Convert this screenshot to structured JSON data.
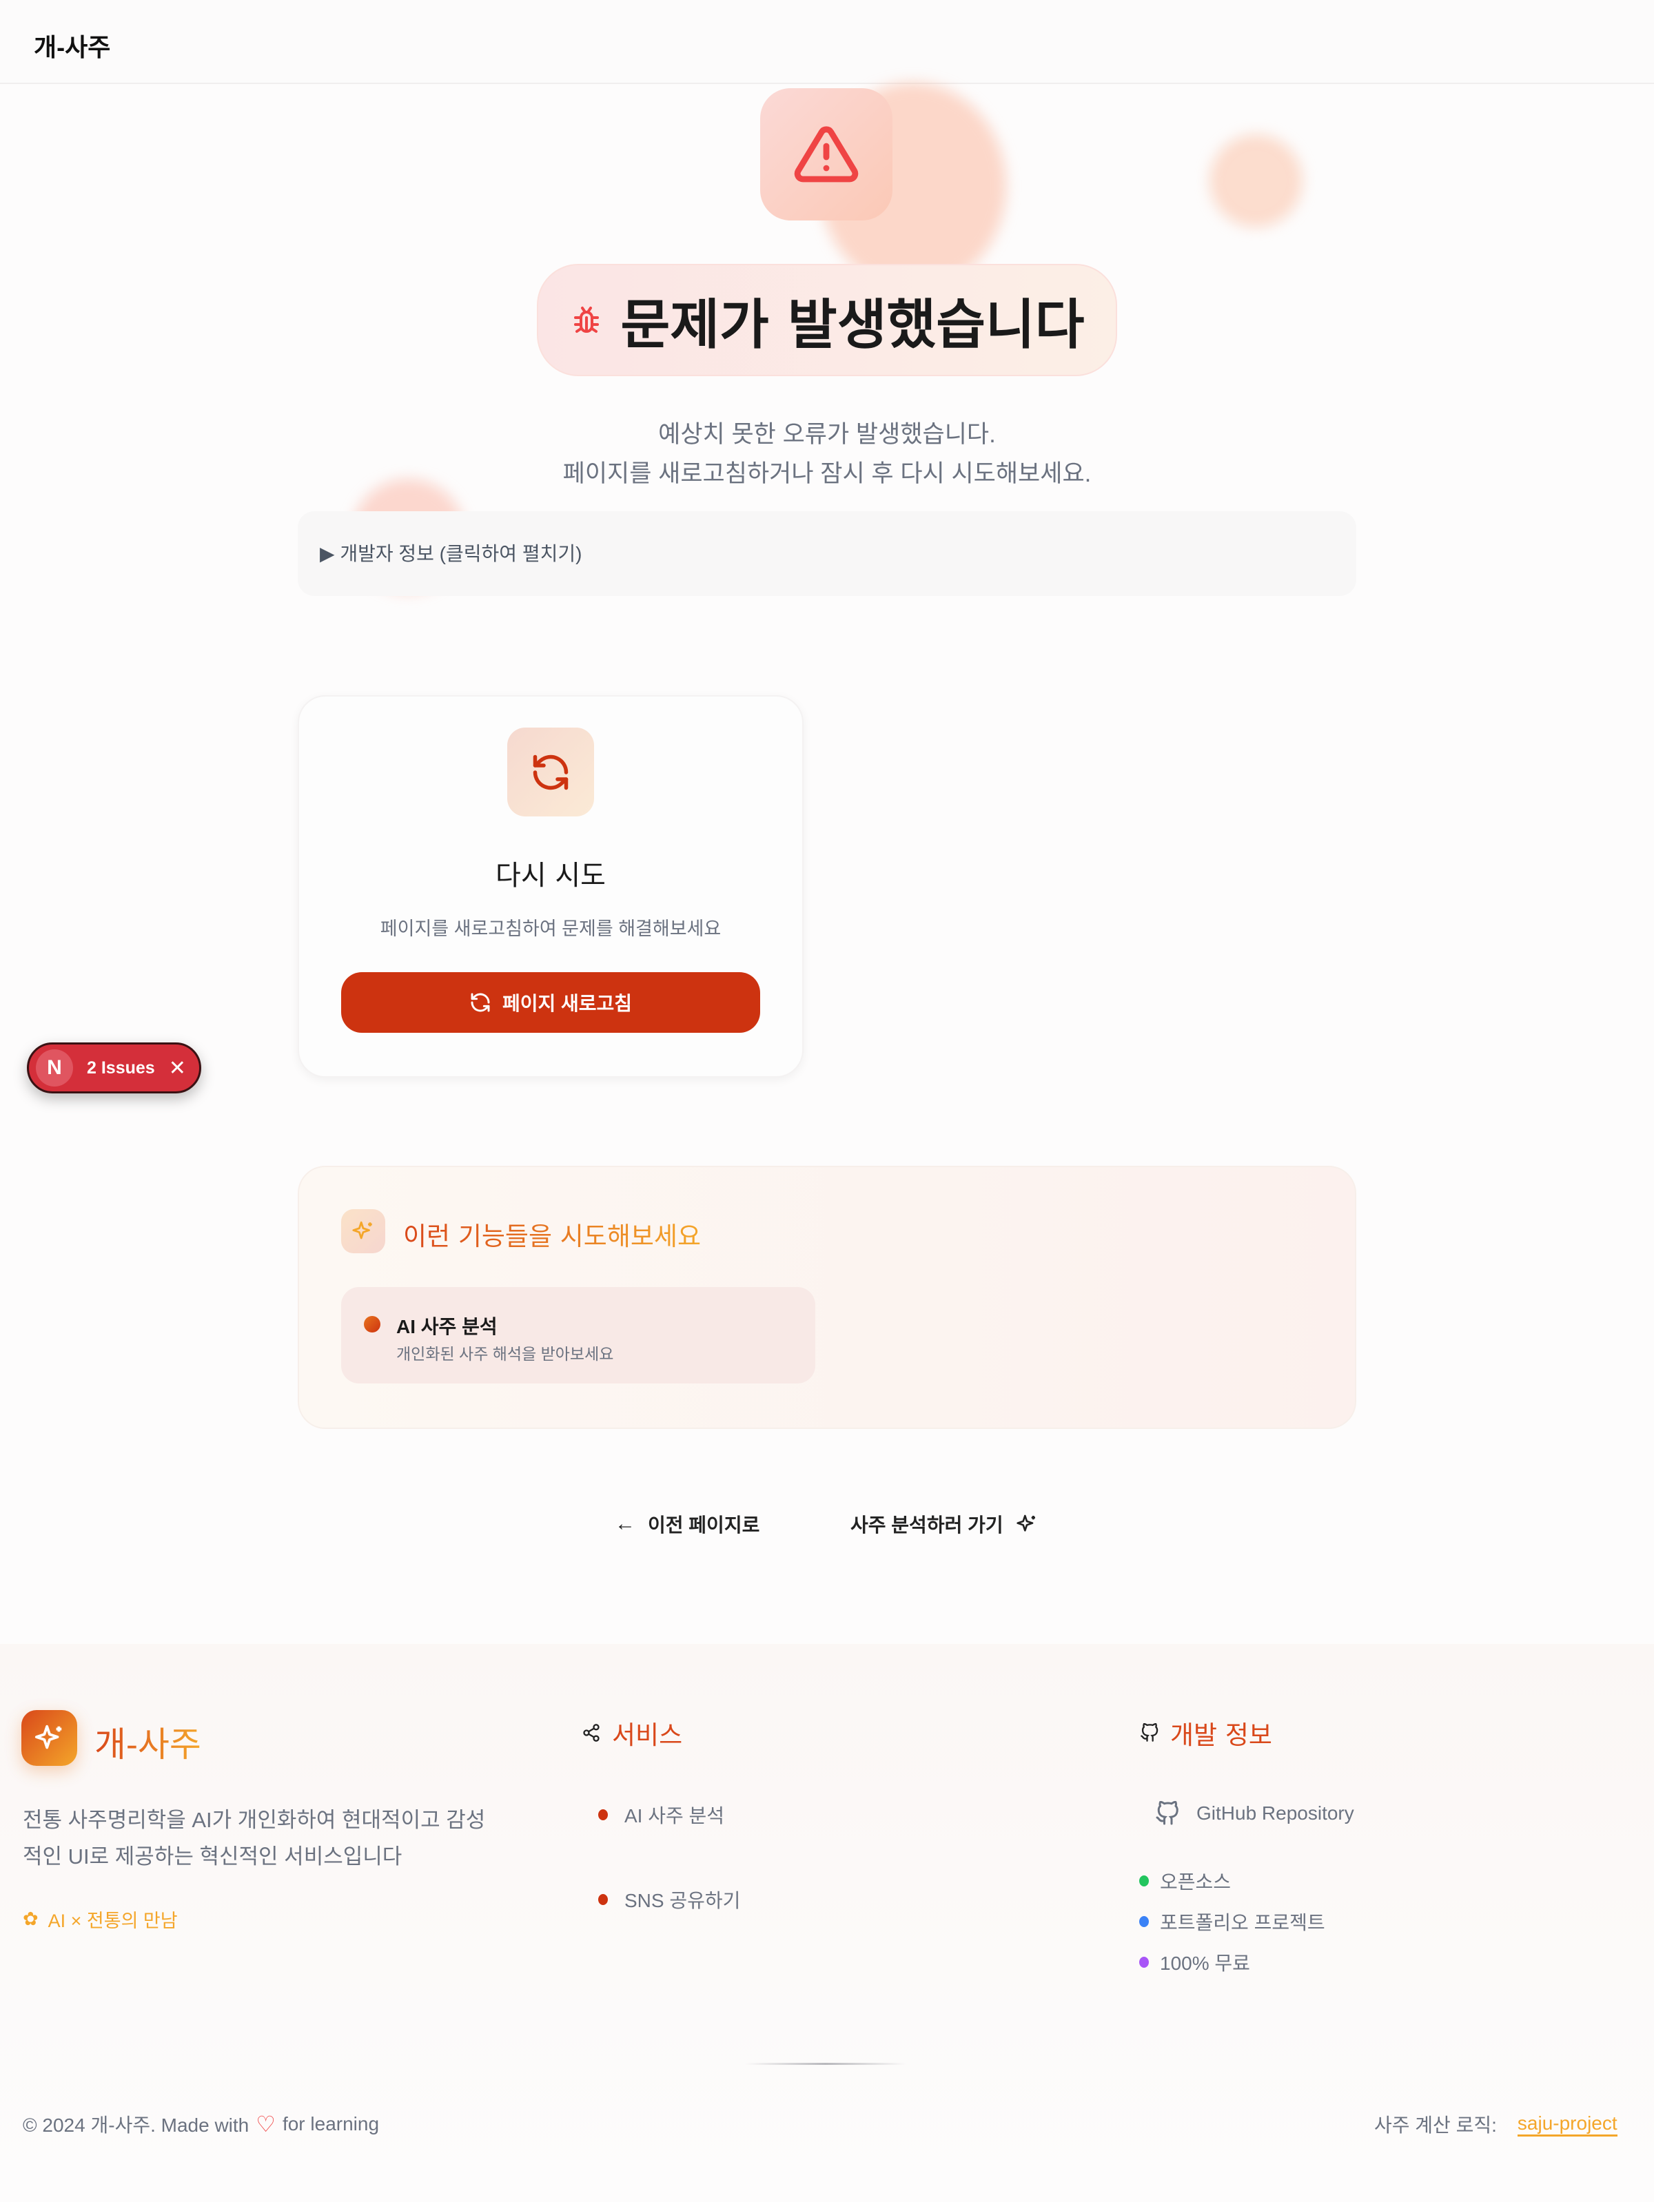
{
  "header": {
    "logo": "개-사주"
  },
  "error": {
    "title": "문제가 발생했습니다",
    "line1": "예상치 못한 오류가 발생했습니다.",
    "line2": "페이지를 새로고침하거나 잠시 후 다시 시도해보세요.",
    "dev_info": "▶ 개발자 정보 (클릭하여 펼치기)"
  },
  "retry_card": {
    "title": "다시 시도",
    "description": "페이지를 새로고침하여 문제를 해결해보세요",
    "button": "페이지 새로고침"
  },
  "issues_badge": {
    "letter": "N",
    "label": "2 Issues"
  },
  "features": {
    "heading": "이런 기능들을 시도해보세요",
    "items": [
      {
        "title": "AI 사주 분석",
        "description": "개인화된 사주 해석을 받아보세요"
      }
    ]
  },
  "nav": {
    "back": "이전 페이지로",
    "analyze": "사주 분석하러 가기"
  },
  "footer": {
    "brand": "개-사주",
    "description_line1": "전통 사주명리학을 AI가 개인화하여 현대적이고 감성",
    "description_line2": "적인 UI로 제공하는 혁신적인 서비스입니다",
    "tagline": "AI × 전통의 만남",
    "services_heading": "서비스",
    "services": [
      "AI 사주 분석",
      "SNS 공유하기"
    ],
    "dev_heading": "개발 정보",
    "github": "GitHub Repository",
    "dev_items": [
      {
        "label": "오픈소스",
        "color": "#22c55e"
      },
      {
        "label": "포트폴리오 프로젝트",
        "color": "#3b82f6"
      },
      {
        "label": "100% 무료",
        "color": "#a855f7"
      }
    ],
    "copyright_prefix": "© 2024 개-사주. Made with",
    "copyright_suffix": "for learning",
    "logic_label": "사주 계산 로직:",
    "logic_link": "saju-project"
  },
  "colors": {
    "accent": "#cd3310",
    "orange": "#e8731e",
    "danger": "#ef4444"
  }
}
